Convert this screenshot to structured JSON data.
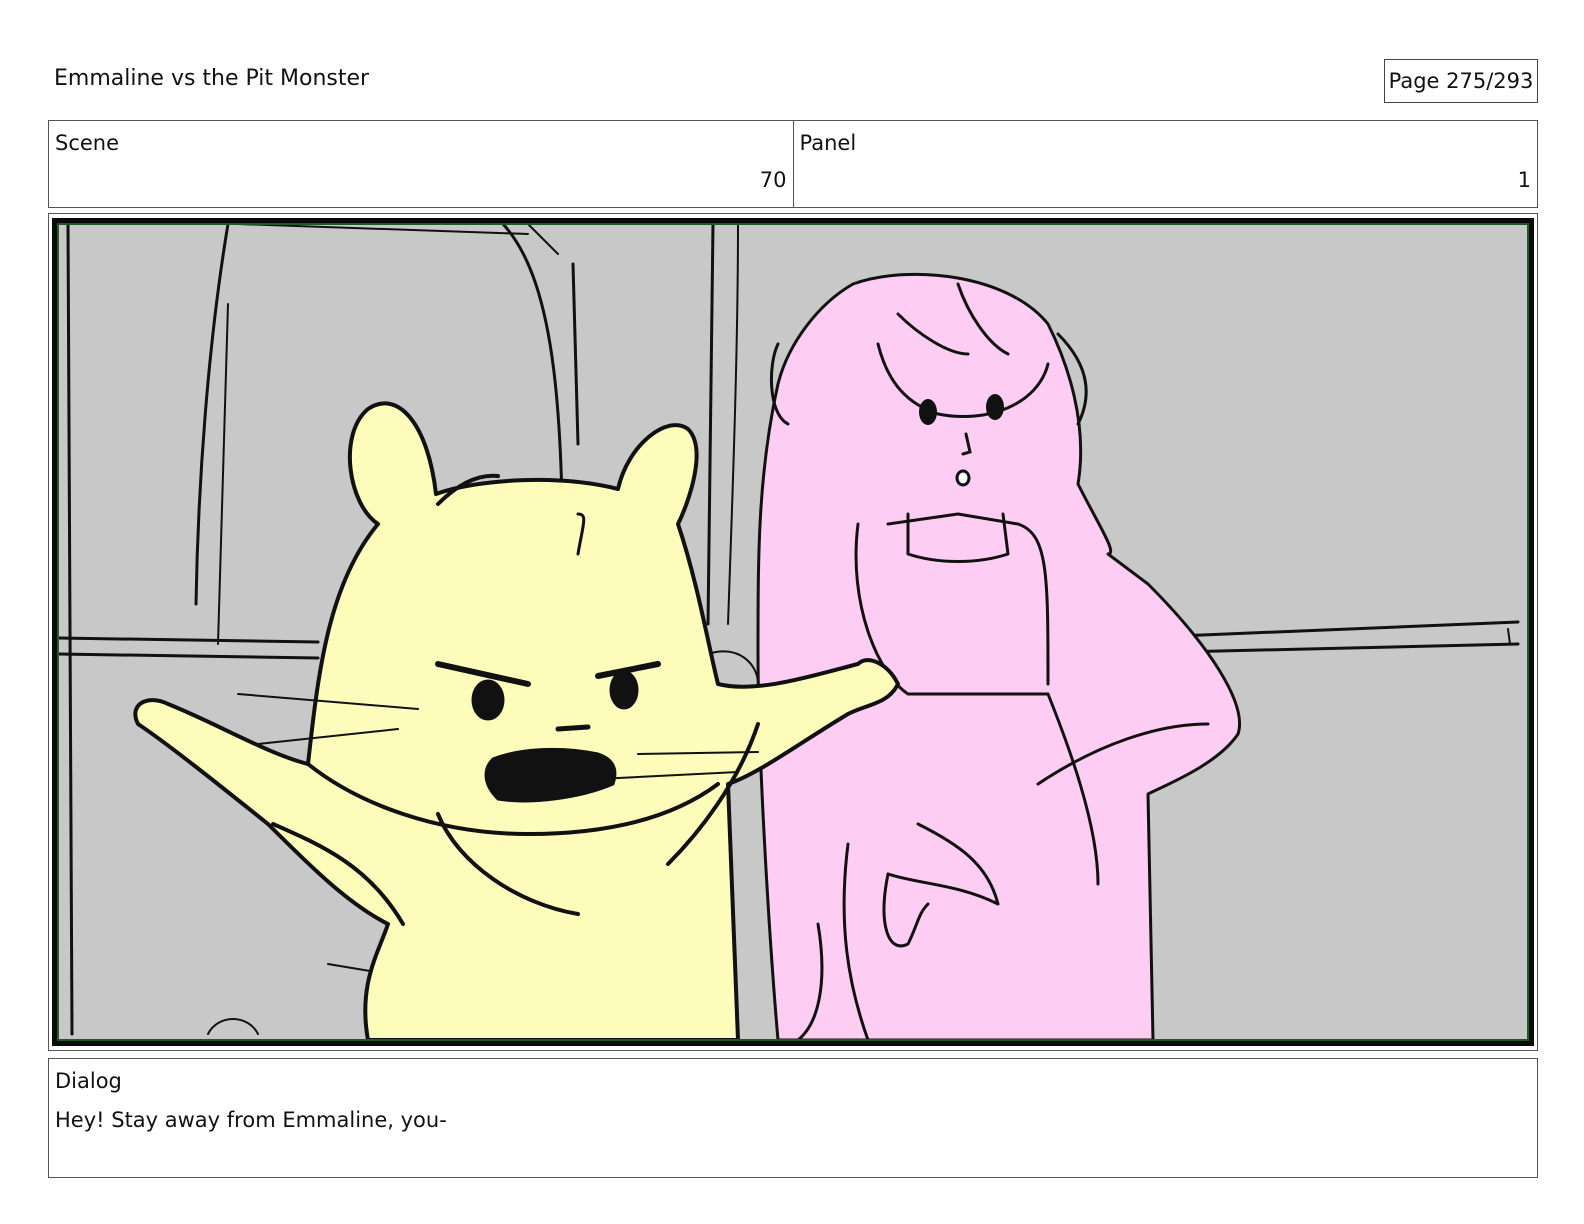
{
  "header": {
    "title": "Emmaline vs the Pit Monster",
    "page_label": "Page 275/293"
  },
  "info": {
    "scene_label": "Scene",
    "scene_value": "70",
    "panel_label": "Panel",
    "panel_value": "1"
  },
  "frame": {
    "subject": "storyboard sketch",
    "colors": {
      "background": "#c8c8c8",
      "hamster_fill": "#fdfcba",
      "girl_fill": "#fdcdf4",
      "line": "#111111"
    }
  },
  "dialog": {
    "label": "Dialog",
    "text": "Hey! Stay away from Emmaline, you-"
  }
}
